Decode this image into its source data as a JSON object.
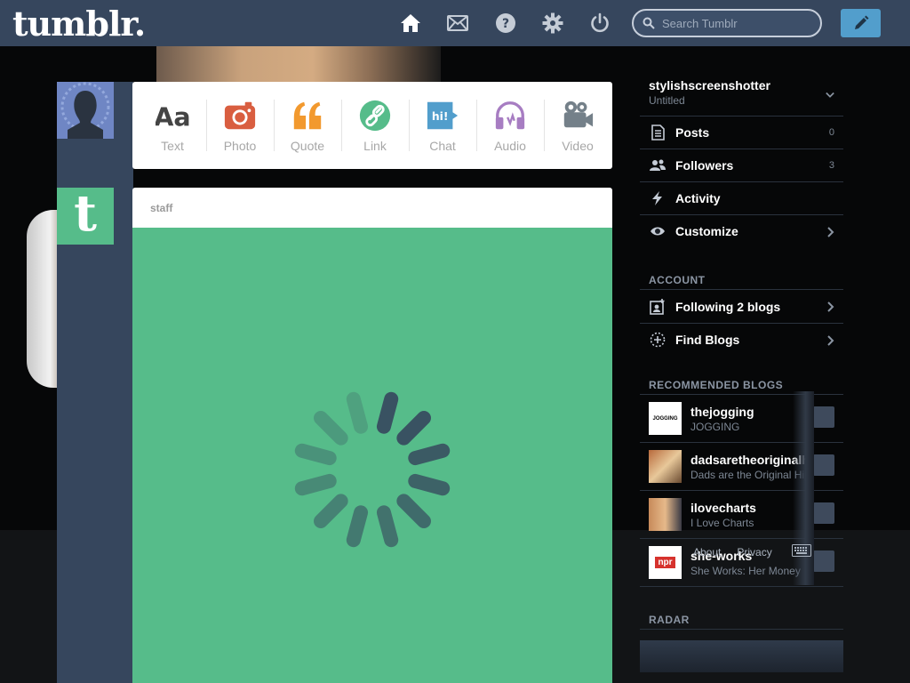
{
  "app": {
    "logo": "tumblr."
  },
  "topbar": {
    "nav": [
      {
        "name": "home-icon"
      },
      {
        "name": "mail-icon"
      },
      {
        "name": "help-icon"
      },
      {
        "name": "gear-icon"
      },
      {
        "name": "power-icon"
      }
    ],
    "search_placeholder": "Search Tumblr",
    "compose_icon": "pencil-icon"
  },
  "post_types": [
    {
      "label": "Text",
      "icon": "text-icon",
      "color": "#444444"
    },
    {
      "label": "Photo",
      "icon": "camera-icon",
      "color": "#d95e40"
    },
    {
      "label": "Quote",
      "icon": "quote-icon",
      "color": "#f2992e"
    },
    {
      "label": "Link",
      "icon": "link-icon",
      "color": "#56bc8a"
    },
    {
      "label": "Chat",
      "icon": "chat-icon",
      "color": "#529ecc"
    },
    {
      "label": "Audio",
      "icon": "headphones-icon",
      "color": "#a77dc2"
    },
    {
      "label": "Video",
      "icon": "video-camera-icon",
      "color": "#748089"
    }
  ],
  "post": {
    "author": "staff",
    "media_color": "#56bc8a"
  },
  "sidebar": {
    "blog_name": "stylishscreenshotter",
    "blog_title": "Untitled",
    "menu": [
      {
        "label": "Posts",
        "count": "0"
      },
      {
        "label": "Followers",
        "count": "3"
      },
      {
        "label": "Activity"
      },
      {
        "label": "Customize"
      }
    ],
    "account_title": "ACCOUNT",
    "account": [
      {
        "label": "Following 2 blogs"
      },
      {
        "label": "Find Blogs"
      }
    ],
    "recommended_title": "RECOMMENDED BLOGS",
    "recommended": [
      {
        "name": "thejogging",
        "desc": "JOGGING",
        "avatar_text": "JOGGING"
      },
      {
        "name": "dadsaretheoriginalhipster",
        "desc": "Dads are the Original Hipster"
      },
      {
        "name": "ilovecharts",
        "desc": "I Love Charts"
      },
      {
        "name": "she-works",
        "desc": "She Works: Her Money",
        "avatar_text": "npr"
      }
    ],
    "radar_title": "RADAR"
  },
  "footer": {
    "about": "About",
    "privacy": "Privacy"
  }
}
